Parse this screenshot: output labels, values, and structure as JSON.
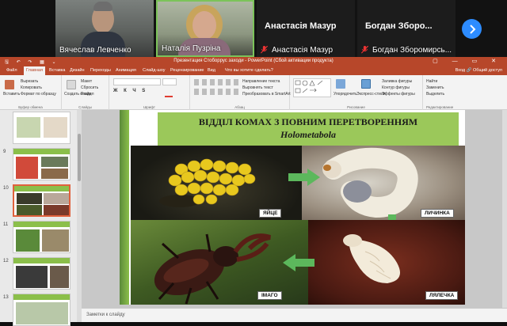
{
  "participants": [
    {
      "name": "Вячеслав Левченко",
      "video": true
    },
    {
      "name": "Наталія Пузріна",
      "video": true,
      "speaking": true
    },
    {
      "display": "Анастасія Мазур",
      "name": "Анастасія Мазур",
      "muted": true
    },
    {
      "display": "Богдан  Зборо...",
      "name": "Богдан Зборомирсь...",
      "muted": true
    }
  ],
  "window": {
    "title": "Презентация Стоборрус заходи - PowerPoint (Сбой активации продукта)",
    "qat": "🖫 ↶ ↷ ▦ ⌄",
    "win_controls": "▢ — ▭ ✕"
  },
  "tabs": [
    "Файл",
    "Главная",
    "Вставка",
    "Дизайн",
    "Переходы",
    "Анимация",
    "Слайд-шоу",
    "Рецензирование",
    "Вид",
    "Что вы хотите сделать?"
  ],
  "tabs_right": "Вход  🔗 Общий доступ",
  "ribbon": {
    "groups": [
      {
        "label": "Буфер обмена",
        "items": [
          "Вставить",
          "Вырезать",
          "Копировать",
          "Формат по образцу"
        ]
      },
      {
        "label": "Слайды",
        "items": [
          "Создать слайд",
          "Макет",
          "Сбросить",
          "Раздел"
        ]
      },
      {
        "label": "Шрифт",
        "items": []
      },
      {
        "label": "Абзац",
        "items": [
          "Направление текста",
          "Выровнять текст",
          "Преобразовать в SmartArt"
        ]
      },
      {
        "label": "Рисование",
        "items": [
          "Упорядочить",
          "Экспресс-стили",
          "Заливка фигуры",
          "Контур фигуры",
          "Эффекты фигуры"
        ]
      },
      {
        "label": "Редактирование",
        "items": [
          "Найти",
          "Заменить",
          "Выделить"
        ]
      }
    ]
  },
  "thumbnails": [
    {
      "num": "",
      "selected": false
    },
    {
      "num": "9",
      "selected": false
    },
    {
      "num": "10",
      "selected": true
    },
    {
      "num": "11",
      "selected": false
    },
    {
      "num": "12",
      "selected": false
    },
    {
      "num": "13",
      "selected": false
    }
  ],
  "slide": {
    "title": "ВІДДІЛ КОМАХ З ПОВНИМ ПЕРЕТВОРЕННЯМ",
    "subtitle": "Holometabola",
    "captions": {
      "egg": "ЯЙЦЕ",
      "larva": "ЛИЧИНКА",
      "pupa": "ЛЯЛЕЧКА",
      "imago": "ІМАГО"
    }
  },
  "notes_placeholder": "Заметки к слайду",
  "colors": {
    "ppt_accent": "#b7472a",
    "slide_title_bg": "#9bc85a",
    "arrow_green": "#5cb85c",
    "zoom_blue": "#2d8cff"
  }
}
